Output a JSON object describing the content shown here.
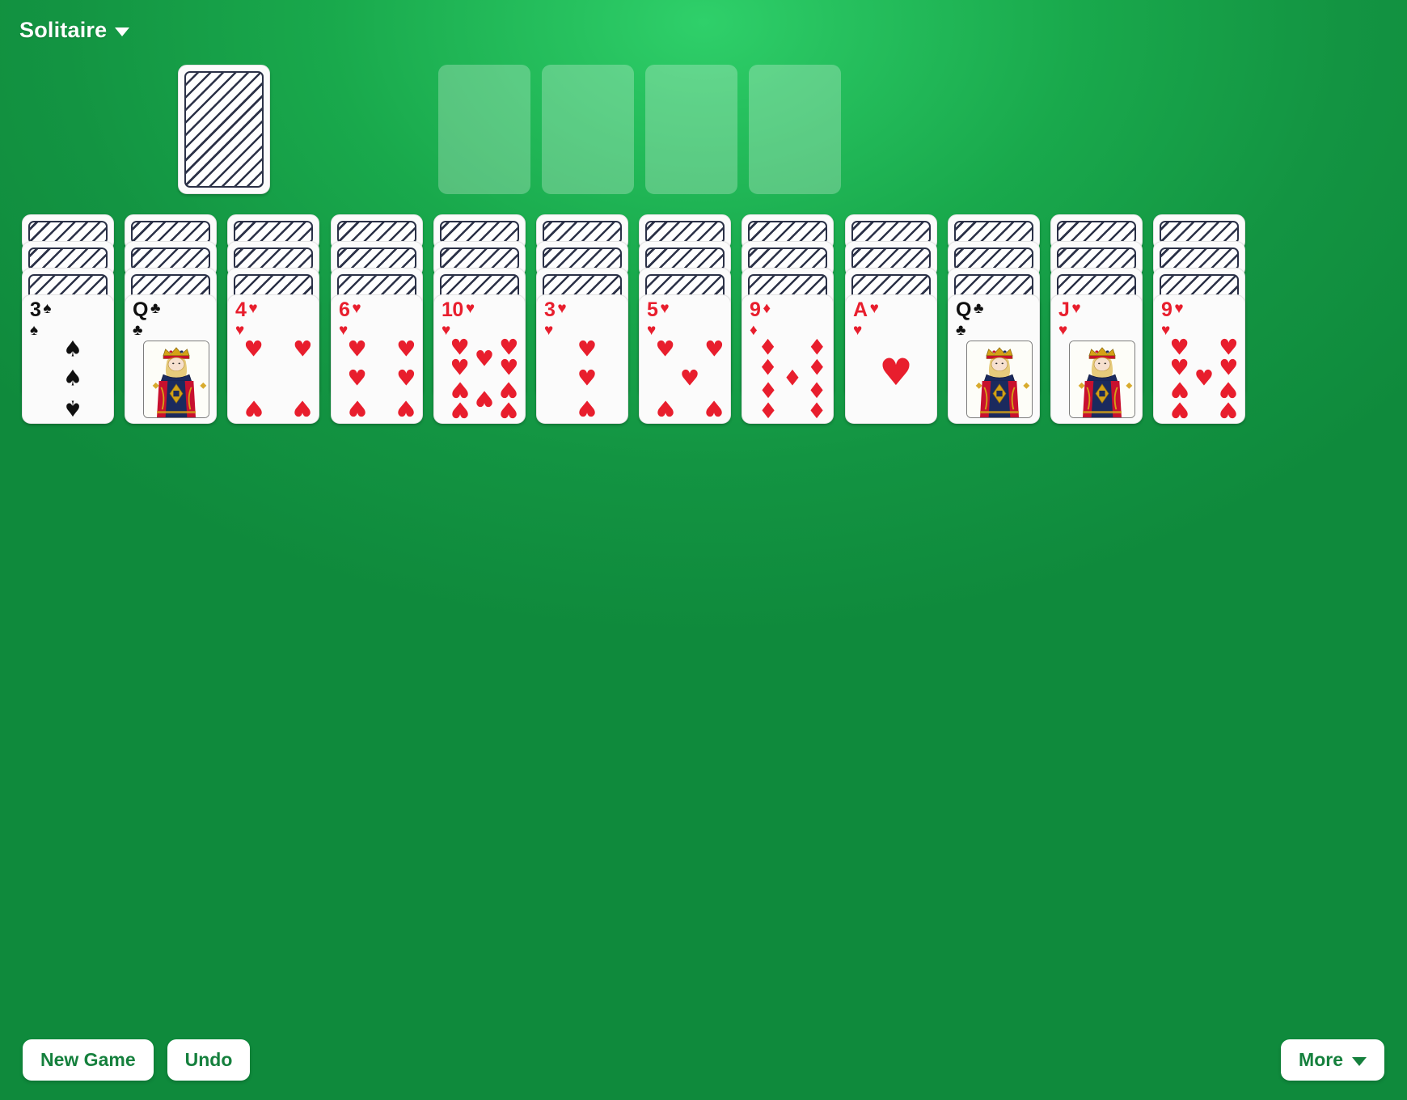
{
  "header": {
    "title": "Solitaire",
    "menu_caret_icon": "chevron-down-icon"
  },
  "board": {
    "stock": {
      "label": "stock-pile",
      "face_down_count": 1
    },
    "foundations": [
      {
        "suit": "spades",
        "empty": true
      },
      {
        "suit": "hearts",
        "empty": true
      },
      {
        "suit": "diamonds",
        "empty": true
      },
      {
        "suit": "clubs",
        "empty": true
      }
    ],
    "tableau": [
      {
        "index": 1,
        "face_down": 3,
        "top_card": {
          "rank": "3",
          "suit": "spades",
          "symbol": "♠",
          "color": "black"
        }
      },
      {
        "index": 2,
        "face_down": 3,
        "top_card": {
          "rank": "Q",
          "suit": "clubs",
          "symbol": "♣",
          "color": "black"
        }
      },
      {
        "index": 3,
        "face_down": 3,
        "top_card": {
          "rank": "4",
          "suit": "hearts",
          "symbol": "♥",
          "color": "red"
        }
      },
      {
        "index": 4,
        "face_down": 3,
        "top_card": {
          "rank": "6",
          "suit": "hearts",
          "symbol": "♥",
          "color": "red"
        }
      },
      {
        "index": 5,
        "face_down": 3,
        "top_card": {
          "rank": "10",
          "suit": "hearts",
          "symbol": "♥",
          "color": "red"
        }
      },
      {
        "index": 6,
        "face_down": 3,
        "top_card": {
          "rank": "3",
          "suit": "hearts",
          "symbol": "♥",
          "color": "red"
        }
      },
      {
        "index": 7,
        "face_down": 3,
        "top_card": {
          "rank": "5",
          "suit": "hearts",
          "symbol": "♥",
          "color": "red"
        }
      },
      {
        "index": 8,
        "face_down": 3,
        "top_card": {
          "rank": "9",
          "suit": "diamonds",
          "symbol": "♦",
          "color": "red"
        }
      },
      {
        "index": 9,
        "face_down": 3,
        "top_card": {
          "rank": "A",
          "suit": "hearts",
          "symbol": "♥",
          "color": "red"
        }
      },
      {
        "index": 10,
        "face_down": 3,
        "top_card": {
          "rank": "Q",
          "suit": "clubs",
          "symbol": "♣",
          "color": "black"
        }
      },
      {
        "index": 11,
        "face_down": 3,
        "top_card": {
          "rank": "J",
          "suit": "hearts",
          "symbol": "♥",
          "color": "red"
        }
      },
      {
        "index": 12,
        "face_down": 3,
        "top_card": {
          "rank": "9",
          "suit": "hearts",
          "symbol": "♥",
          "color": "red"
        }
      }
    ]
  },
  "toolbar": {
    "new_game_label": "New Game",
    "undo_label": "Undo",
    "more_label": "More",
    "more_caret_icon": "chevron-down-icon"
  },
  "colors": {
    "felt_light": "#2fd06a",
    "felt_dark": "#0f8a3c",
    "slot_fill": "rgba(255,255,255,0.26)",
    "card_face": "#fbfbfb",
    "card_back_ink": "#2b3147",
    "red_suit": "#e81e2d",
    "black_suit": "#101010",
    "button_text": "#15803d",
    "button_bg": "#ffffff"
  }
}
